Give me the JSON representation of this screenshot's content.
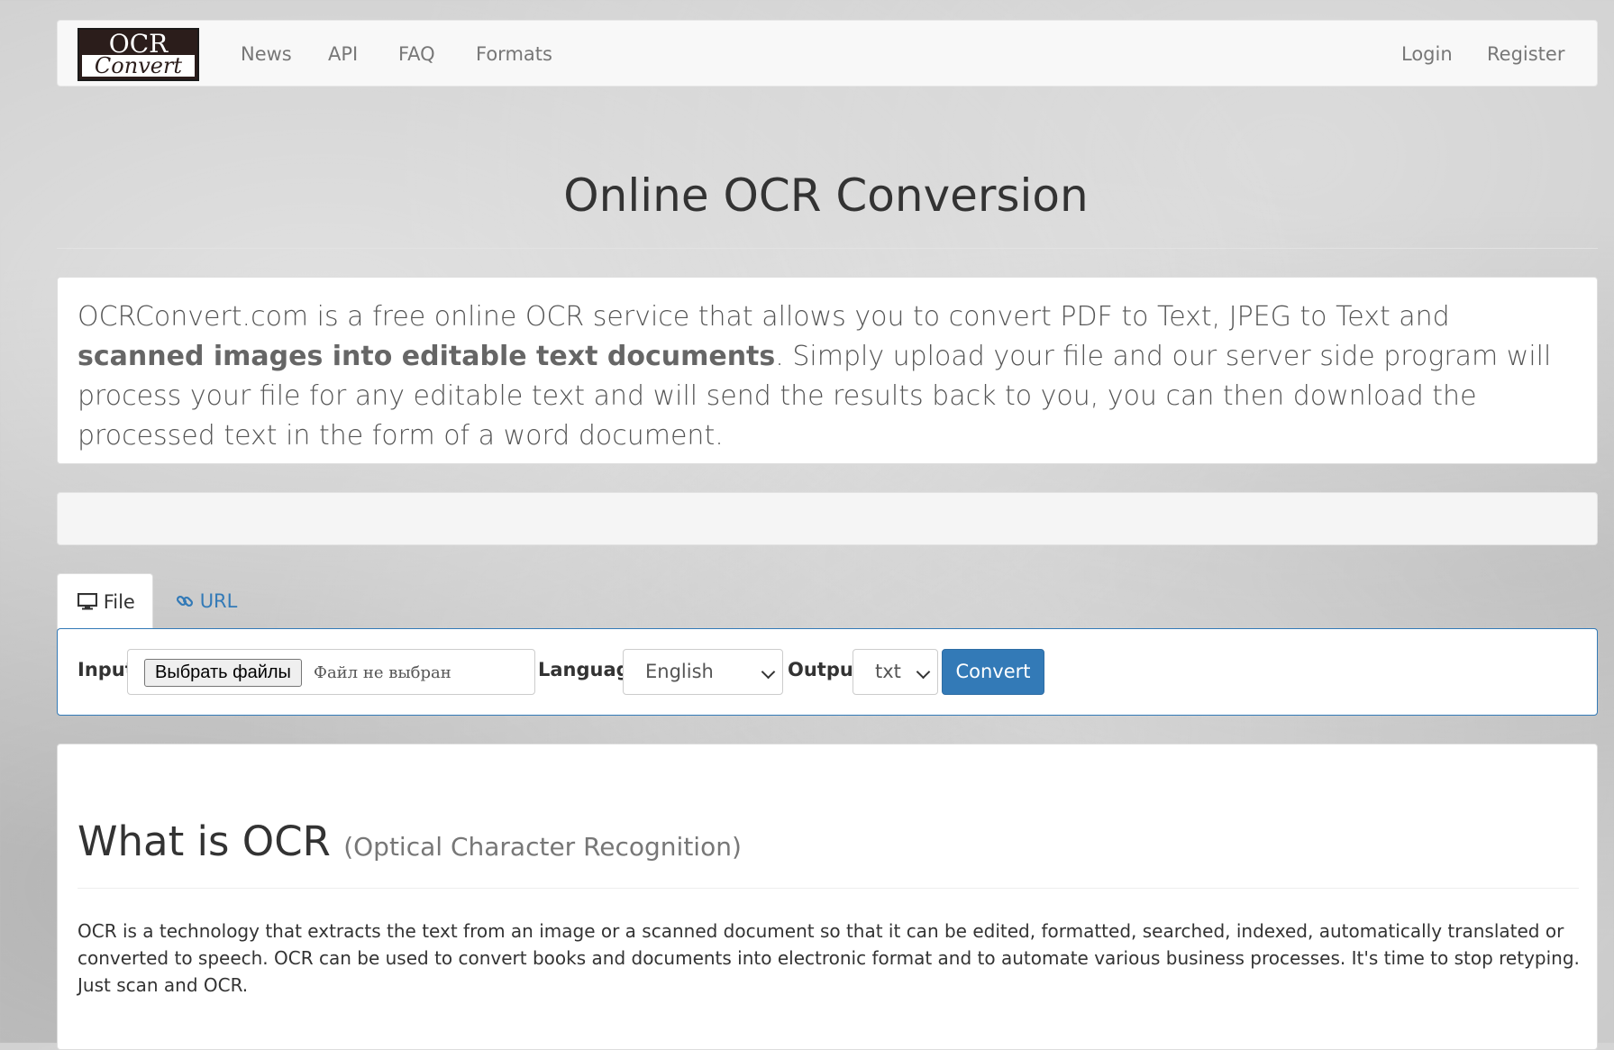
{
  "brand": {
    "logo_top": "OCR",
    "logo_bottom": "Convert"
  },
  "nav": {
    "left": [
      "News",
      "API",
      "FAQ",
      "Formats"
    ],
    "right": [
      "Login",
      "Register"
    ]
  },
  "page_title": "Online OCR Conversion",
  "intro": {
    "text_a": "OCRConvert.com is a free online OCR service that allows you to convert PDF to Text, JPEG to Text and ",
    "text_bold": "scanned images into editable text documents",
    "text_b": ". Simply upload your file and our server side program will process your file for any editable text and will send the results back to you, you can then download the processed text in the form of a word document."
  },
  "tabs": {
    "file": "File",
    "url": "URL"
  },
  "form": {
    "input_label": "Input",
    "file_button": "Выбрать файлы",
    "file_status": "Файл не выбран",
    "language_label": "Language",
    "language_value": "English",
    "output_label": "Output",
    "output_value": "txt",
    "convert_label": "Convert"
  },
  "section": {
    "heading": "What is OCR",
    "heading_small": "(Optical Character Recognition)",
    "body": "OCR is a technology that extracts the text from an image or a scanned document so that it can be edited, formatted, searched, indexed, automatically translated or converted to speech. OCR can be used to convert books and documents into electronic format and to automate various business processes. It's time to stop retyping. Just scan and OCR."
  },
  "colors": {
    "primary": "#337ab7",
    "nav_text": "#777777",
    "logo_bg": "#2b1d1b"
  }
}
